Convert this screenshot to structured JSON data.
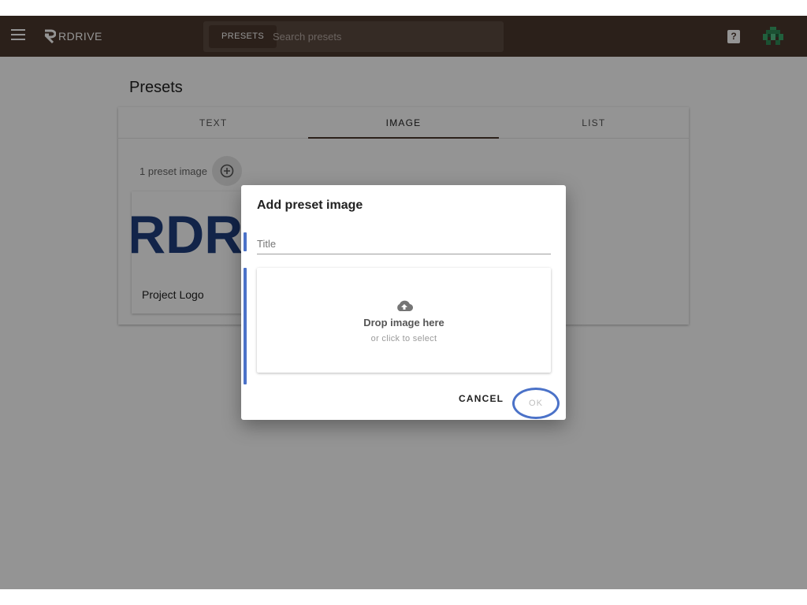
{
  "header": {
    "logo_text": "RDRIVE",
    "search_chip": "PRESETS",
    "search_placeholder": "Search presets",
    "help_label": "?"
  },
  "page": {
    "title": "Presets",
    "tabs": [
      {
        "label": "TEXT",
        "active": false
      },
      {
        "label": "IMAGE",
        "active": true
      },
      {
        "label": "LIST",
        "active": false
      }
    ],
    "count_label": "1 preset image",
    "count": 1,
    "card": {
      "image_text": "RDR",
      "title": "Project Logo"
    }
  },
  "dialog": {
    "title": "Add preset image",
    "title_placeholder": "Title",
    "dropzone_text": "Drop image here",
    "dropzone_subtext": "or click to select",
    "cancel_label": "CANCEL",
    "ok_label": "OK"
  },
  "colors": {
    "topbar": "#4a382d",
    "accent": "#4b72c8",
    "logo_blue": "#1f3f7e"
  },
  "icons": {
    "menu": "menu-icon",
    "help": "help-icon",
    "avatar": "avatar-icon",
    "add": "plus-circle-icon",
    "upload": "cloud-upload-icon"
  }
}
